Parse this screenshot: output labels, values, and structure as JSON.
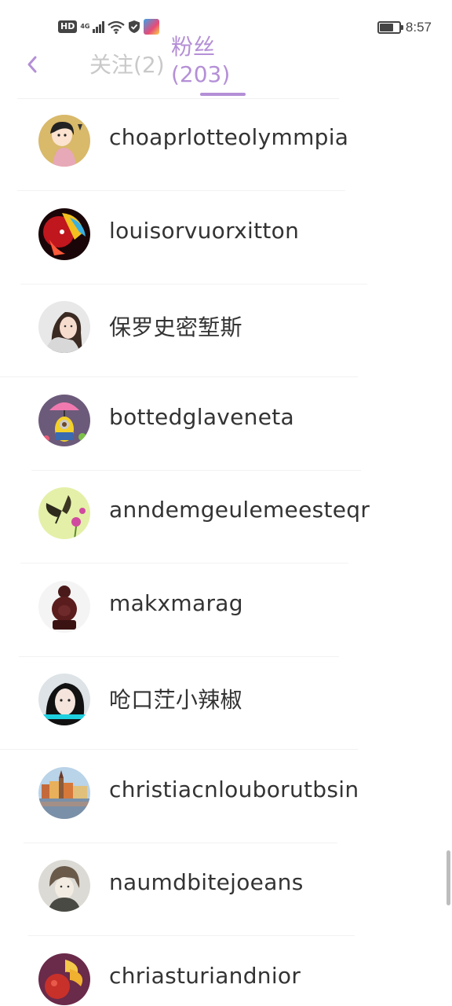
{
  "status_bar": {
    "hd_badge": "HD",
    "network": "4G",
    "time": "8:57",
    "battery_level": 0.7
  },
  "header": {
    "tab_follow": "关注(2)",
    "tab_fans_line1": "粉丝",
    "tab_fans_line2": "(203)",
    "accent_color": "#b48fd6"
  },
  "fans": [
    {
      "username": "choaprlotteolymmpia",
      "avatar_icon": "cartoon-girl-avatar"
    },
    {
      "username": "louisorvuorxitton",
      "avatar_icon": "anime-red-avatar"
    },
    {
      "username": "保罗史密堑斯",
      "avatar_icon": "girl-photo-avatar"
    },
    {
      "username": "bottedglaveneta",
      "avatar_icon": "minion-umbrella-avatar"
    },
    {
      "username": "anndemgeulemeesteqr",
      "avatar_icon": "butterfly-flower-avatar"
    },
    {
      "username": "makxmarag",
      "avatar_icon": "buddha-statue-avatar"
    },
    {
      "username": "呛口茳小辣椒",
      "avatar_icon": "girl-portrait-avatar"
    },
    {
      "username": "christiacnlouborutbsin",
      "avatar_icon": "city-harbor-avatar"
    },
    {
      "username": "naumdbitejoeans",
      "avatar_icon": "sketch-portrait-avatar"
    },
    {
      "username": "chriasturiandnior",
      "avatar_icon": "fruit-flower-avatar"
    }
  ]
}
